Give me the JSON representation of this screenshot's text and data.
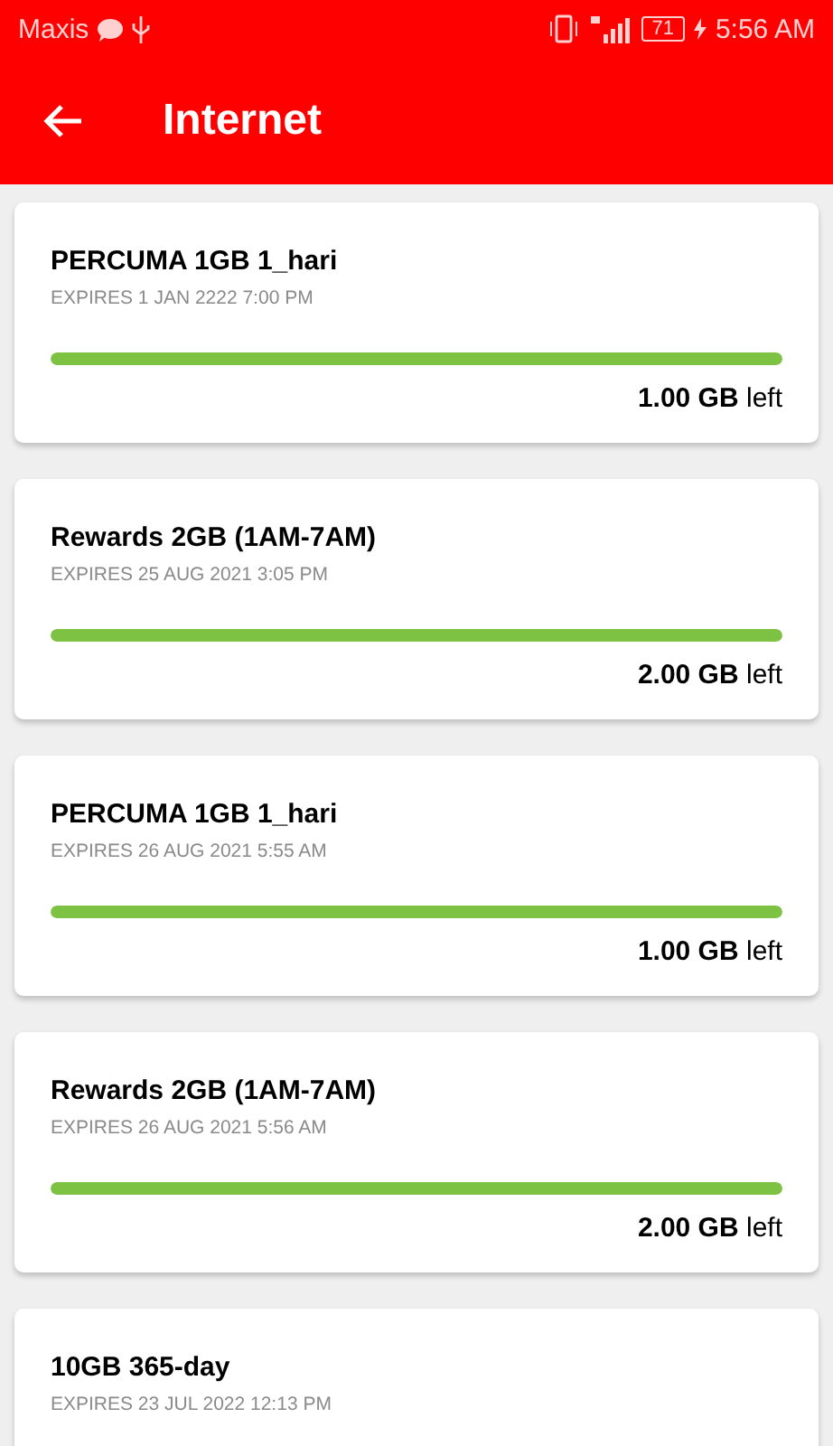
{
  "status_bar": {
    "carrier": "Maxis",
    "battery": "71",
    "time": "5:56 AM"
  },
  "header": {
    "title": "Internet"
  },
  "plans": [
    {
      "name": "PERCUMA 1GB 1_hari",
      "expires": "EXPIRES 1 JAN 2222 7:00 PM",
      "level": 1,
      "remaining": "**1.00 GB** left"
    },
    {
      "name": "Rewards 2GB (1AM-7AM)",
      "expires": "EXPIRES 25 AUG 2021 3:05 PM",
      "level": 1,
      "remaining": "**2.00 GB** left"
    },
    {
      "name": "PERCUMA 1GB 1_hari",
      "expires": "EXPIRES 26 AUG 2021 5:55 AM",
      "level": 1,
      "remaining": "**1.00 GB** left"
    },
    {
      "name": "Rewards 2GB (1AM-7AM)",
      "expires": "EXPIRES 26 AUG 2021 5:56 AM",
      "level": 1,
      "remaining": "**2.00 GB** left"
    },
    {
      "name": "10GB 365-day",
      "expires": "EXPIRES 23 JUL 2022 12:13 PM"
    }
  ]
}
